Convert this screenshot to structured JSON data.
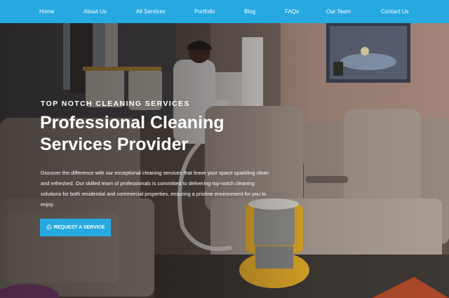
{
  "nav": {
    "items": [
      {
        "label": "Home"
      },
      {
        "label": "About Us"
      },
      {
        "label": "All Services"
      },
      {
        "label": "Portfolio"
      },
      {
        "label": "Blog"
      },
      {
        "label": "FAQs"
      },
      {
        "label": "Our Team"
      },
      {
        "label": "Contact Us"
      }
    ]
  },
  "hero": {
    "eyebrow": "TOP NOTCH CLEANING SERVICES",
    "title_line1": "Professional Cleaning",
    "title_line2": "Services Provider",
    "description": "Discover the difference with our exceptional cleaning services that leave your space sparkling clean and refreshed. Our skilled team of professionals is committed to delivering top-notch cleaning solutions for both residential and commercial properties, ensuring a pristine environment for you to enjoy.",
    "cta_label": "REQUEST A SERVICE",
    "cta_icon": "whatsapp-icon"
  },
  "colors": {
    "nav_bg": "#25a9e0",
    "cta_bg": "#25a9e0",
    "text": "#ffffff"
  }
}
